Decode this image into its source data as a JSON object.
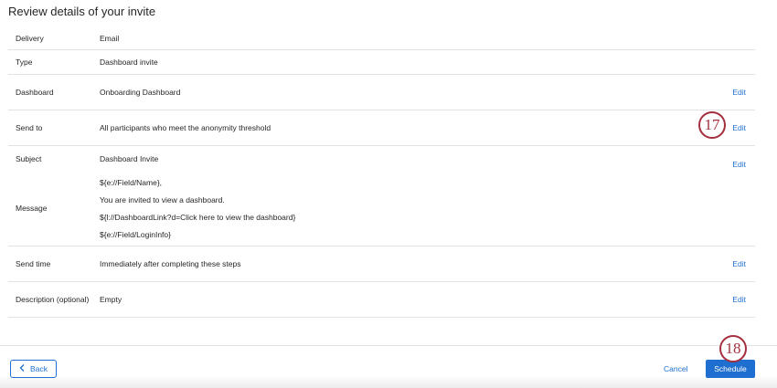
{
  "page": {
    "title": "Review details of your invite"
  },
  "rows": [
    {
      "label": "Delivery",
      "value": "Email"
    },
    {
      "label": "Type",
      "value": "Dashboard invite"
    },
    {
      "label": "Dashboard",
      "value": "Onboarding Dashboard",
      "edit": "Edit"
    },
    {
      "label": "Send to",
      "value": "All participants who meet the anonymity threshold",
      "edit": "Edit"
    },
    {
      "label": "Subject",
      "value": "Dashboard Invite",
      "edit": "Edit"
    },
    {
      "label": "Message",
      "lines": [
        "${e://Field/Name},",
        "You are invited to view a dashboard.",
        "${l://DashboardLink?d=Click here to view the dashboard}",
        "${e://Field/LoginInfo}"
      ]
    },
    {
      "label": "Send time",
      "value": "Immediately after completing these steps",
      "edit": "Edit"
    },
    {
      "label": "Description (optional)",
      "value": "Empty",
      "edit": "Edit"
    }
  ],
  "footer": {
    "back_label": "Back",
    "cancel_label": "Cancel",
    "schedule_label": "Schedule"
  },
  "callouts": {
    "send_to": "17",
    "schedule": "18"
  },
  "colors": {
    "accent": "#1f6fd1",
    "callout": "#a4303f"
  }
}
